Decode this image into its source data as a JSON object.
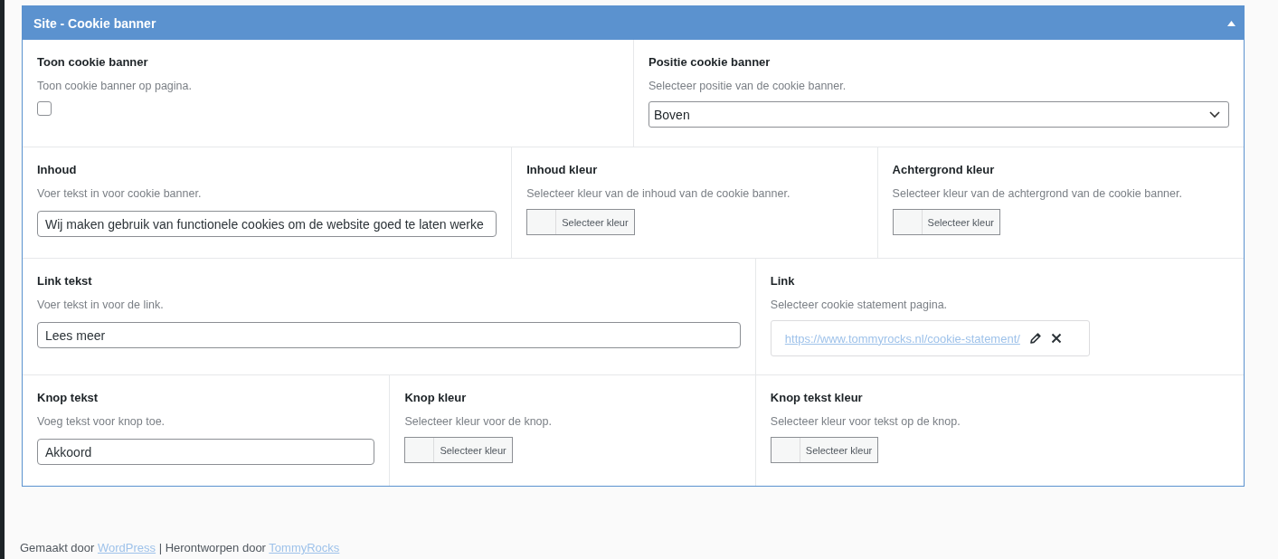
{
  "panel": {
    "title": "Site - Cookie banner",
    "expanded": true,
    "rows": [
      [
        {
          "kind": "checkbox",
          "label": "Toon cookie banner",
          "description": "Toon cookie banner op pagina.",
          "checked": false
        },
        {
          "kind": "select",
          "label": "Positie cookie banner",
          "description": "Selecteer positie van de cookie banner.",
          "value": "Boven"
        }
      ],
      [
        {
          "kind": "text",
          "label": "Inhoud",
          "description": "Voer tekst in voor cookie banner.",
          "value": "Wij maken gebruik van functionele cookies om de website goed te laten werke"
        },
        {
          "kind": "color",
          "label": "Inhoud kleur",
          "description": "Selecteer kleur van de inhoud van de cookie banner.",
          "button": "Selecteer kleur"
        },
        {
          "kind": "color",
          "label": "Achtergrond kleur",
          "description": "Selecteer kleur van de achtergrond van de cookie banner.",
          "button": "Selecteer kleur"
        }
      ],
      [
        {
          "kind": "text",
          "label": "Link tekst",
          "description": "Voer tekst in voor de link.",
          "value": "Lees meer"
        },
        {
          "kind": "link",
          "label": "Link",
          "description": "Selecteer cookie statement pagina.",
          "url": "https://www.tommyrocks.nl/cookie-statement/"
        }
      ],
      [
        {
          "kind": "text",
          "label": "Knop tekst",
          "description": "Voeg tekst voor knop toe.",
          "value": "Akkoord"
        },
        {
          "kind": "color",
          "label": "Knop kleur",
          "description": "Selecteer kleur voor de knop.",
          "button": "Selecteer kleur"
        },
        {
          "kind": "color",
          "label": "Knop tekst kleur",
          "description": "Selecteer kleur voor tekst op de knop.",
          "button": "Selecteer kleur"
        }
      ]
    ]
  },
  "footer": {
    "text_1": "Gemaakt door",
    "link_1": "WordPress",
    "text_2": "| Herontworpen door",
    "link_2": "TommyRocks"
  }
}
